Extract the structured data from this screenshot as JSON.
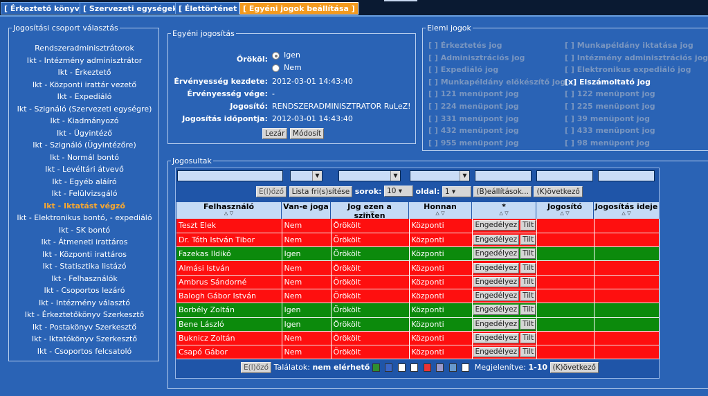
{
  "tabs": [
    "[ Érkeztető könyv ]",
    "[ Szervezeti egységek ]",
    "[ Élettörténet ]",
    "[ Egyéni jogok beállítása ]"
  ],
  "group_panel": {
    "legend": "Jogosítási csoport választás",
    "items": [
      "Rendszeradminisztrátorok",
      "Ikt - Intézmény adminisztrátor",
      "Ikt - Érkeztető",
      "Ikt - Központi irattár vezető",
      "Ikt - Expediáló",
      "Ikt - Szignáló (Szervezeti egységre)",
      "Ikt - Kiadmányozó",
      "Ikt - Ügyintéző",
      "Ikt - Szignáló (Ügyintézőre)",
      "Ikt - Normál bontó",
      "Ikt - Levéltári átvevő",
      "Ikt - Egyéb aláíró",
      "Ikt - Felülvizsgáló",
      "Ikt - Iktatást végző",
      "Ikt - Elektronikus bontó, - expediáló",
      "Ikt - SK bontó",
      "Ikt - Átmeneti irattáros",
      "Ikt - Központi irattáros",
      "Ikt - Statisztika listázó",
      "Ikt - Felhasználók",
      "Ikt - Csoportos lezáró",
      "Ikt - Intézmény választó",
      "Ikt - Érkeztetőkönyv Szerkesztő",
      "Ikt - Postakönyv Szerkesztő",
      "Ikt - Iktatókönyv Szerkesztő",
      "Ikt - Csoportos felcsatoló"
    ]
  },
  "individual": {
    "legend": "Egyéni jogosítás",
    "inherit_label": "Örököl:",
    "opt_yes": "Igen",
    "opt_no": "Nem",
    "valid_from_label": "Érvényesség kezdete:",
    "valid_from": "2012-03-01 14:43:40",
    "valid_to_label": "Érvényesség vége:",
    "valid_to": "-",
    "grantor_label": "Jogosító:",
    "grantor": "RENDSZERADMINISZTRATOR RuLeZ!",
    "grant_time_label": "Jogosítás időpontja:",
    "grant_time": "2012-03-01 14:43:40",
    "close_btn": "Lezár",
    "modify_btn": "Módosít"
  },
  "elemental": {
    "legend": "Elemi jogok",
    "left": [
      "[ ] Érkeztetés jog",
      "[ ] Adminisztrációs jog",
      "[ ] Expediáló jog",
      "[ ] Munkapéldány előkészítő jog",
      "[ ] 121 menüpont jog",
      "[ ] 224 menüpont jog",
      "[ ] 331 menüpont jog",
      "[ ] 432 menüpont jog",
      "[ ] 955 menüpont jog"
    ],
    "right": [
      "[ ] Munkapéldány iktatása jog",
      "[ ] Intézmény adminisztrációs jog",
      "[ ] Elektronikus expediáló jog",
      "[x] Elszámoltató jog",
      "[ ] 122 menüpont jog",
      "[ ] 225 menüpont jog",
      "[ ] 39 menüpont jog",
      "[ ] 433 menüpont jog",
      "[ ] 98 menüpont jog"
    ]
  },
  "grantees": {
    "legend": "Jogosultak",
    "prev_btn": "E(l)őző",
    "refresh_btn": "Lista fri(s)sítése",
    "rows_label": "sorok:",
    "rows_value": "10",
    "page_label": "oldal:",
    "page_value": "1",
    "settings_btn": "(B)eállítások...",
    "next_btn": "(K)övetkező",
    "columns": [
      "Felhasználó",
      "Van-e joga",
      "Jog ezen a szinten",
      "Honnan",
      "*",
      "Jogosító",
      "Jogosítás ideje"
    ],
    "approve_btn": "Engedélyez",
    "deny_btn": "Tilt",
    "rows": [
      {
        "user": "Teszt Elek",
        "has": "Nem",
        "level": "Örökölt",
        "from": "Központi",
        "status": "red"
      },
      {
        "user": "Dr. Tóth István Tibor",
        "has": "Nem",
        "level": "Örökölt",
        "from": "Központi",
        "status": "red"
      },
      {
        "user": "Fazekas Ildikó",
        "has": "Igen",
        "level": "Örökölt",
        "from": "Központi",
        "status": "green"
      },
      {
        "user": "Almási István",
        "has": "Nem",
        "level": "Örökölt",
        "from": "Központi",
        "status": "red"
      },
      {
        "user": "Ambrus Sándorné",
        "has": "Nem",
        "level": "Örökölt",
        "from": "Központi",
        "status": "red"
      },
      {
        "user": "Balogh Gábor István",
        "has": "Nem",
        "level": "Örökölt",
        "from": "Központi",
        "status": "red"
      },
      {
        "user": "Borbély Zoltán",
        "has": "Igen",
        "level": "Örökölt",
        "from": "Központi",
        "status": "green"
      },
      {
        "user": "Bene László",
        "has": "Igen",
        "level": "Örökölt",
        "from": "Központi",
        "status": "green"
      },
      {
        "user": "Buknicz Zoltán",
        "has": "Nem",
        "level": "Örökölt",
        "from": "Központi",
        "status": "red"
      },
      {
        "user": "Csapó Gábor",
        "has": "Nem",
        "level": "Örökölt",
        "from": "Központi",
        "status": "red"
      }
    ],
    "footer_prev": "E(l)őző",
    "results_label": "Találatok:",
    "results_value": "nem elérhető",
    "shown_label": "Megjelenítve:",
    "shown_value": "1-10",
    "footer_next": "(K)övetkező"
  },
  "colors": {
    "accent": "#f39a1e",
    "bg": "#2a63b5",
    "yes": "#0c8a0c",
    "no": "#fe0f0f"
  }
}
